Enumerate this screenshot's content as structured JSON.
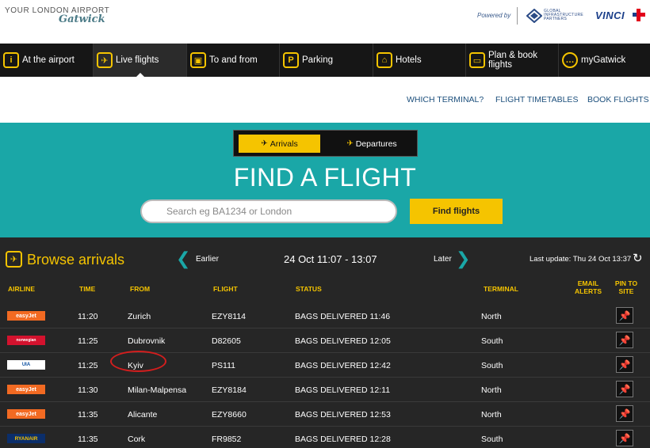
{
  "brand": {
    "tagline": "YOUR LONDON AIRPORT",
    "name": "Gatwick",
    "powered_by": "Powered by",
    "partner_lines": [
      "GLOBAL",
      "INFRASTRUCTURE",
      "PARTNERS"
    ],
    "partner2": "VINCI"
  },
  "nav": {
    "items": [
      {
        "label": "At the airport",
        "icon": "info-icon",
        "glyph": "i"
      },
      {
        "label": "Live flights",
        "icon": "plane-icon",
        "glyph": "✈"
      },
      {
        "label": "To and from",
        "icon": "train-icon",
        "glyph": "▣"
      },
      {
        "label": "Parking",
        "icon": "parking-icon",
        "glyph": "P"
      },
      {
        "label": "Hotels",
        "icon": "bed-icon",
        "glyph": "⌂"
      },
      {
        "label": "Plan & book flights",
        "icon": "ticket-icon",
        "glyph": "▭"
      },
      {
        "label": "myGatwick",
        "icon": "chat-icon",
        "glyph": "…"
      }
    ]
  },
  "sublinks": [
    "WHICH TERMINAL?",
    "FLIGHT TIMETABLES",
    "BOOK FLIGHTS"
  ],
  "hero": {
    "arrivals": "Arrivals",
    "departures": "Departures",
    "title": "FIND A FLIGHT",
    "search_placeholder": "Search eg BA1234 or London",
    "find_button": "Find flights"
  },
  "browse": {
    "title": "Browse arrivals",
    "earlier": "Earlier",
    "range": "24 Oct  11:07 - 13:07",
    "later": "Later",
    "last_update": "Last update: Thu 24 Oct 13:37"
  },
  "table": {
    "headers": {
      "airline": "AIRLINE",
      "time": "TIME",
      "from": "FROM",
      "flight": "FLIGHT",
      "status": "STATUS",
      "terminal": "TERMINAL",
      "email": [
        "EMAIL",
        "ALERTS"
      ],
      "pin": [
        "PIN TO",
        "SITE"
      ]
    },
    "rows": [
      {
        "airline": "easyJet",
        "time": "11:20",
        "from": "Zurich",
        "flight": "EZY8114",
        "status": "BAGS DELIVERED 11:46",
        "terminal": "North"
      },
      {
        "airline": "norwegian",
        "time": "11:25",
        "from": "Dubrovnik",
        "flight": "D82605",
        "status": "BAGS DELIVERED 12:05",
        "terminal": "South"
      },
      {
        "airline": "UIA",
        "time": "11:25",
        "from": "Kyiv",
        "flight": "PS111",
        "status": "BAGS DELIVERED 12:42",
        "terminal": "South"
      },
      {
        "airline": "easyJet",
        "time": "11:30",
        "from": "Milan-Malpensa",
        "flight": "EZY8184",
        "status": "BAGS DELIVERED 12:11",
        "terminal": "North"
      },
      {
        "airline": "easyJet",
        "time": "11:35",
        "from": "Alicante",
        "flight": "EZY8660",
        "status": "BAGS DELIVERED 12:53",
        "terminal": "North"
      },
      {
        "airline": "RYANAIR",
        "time": "11:35",
        "from": "Cork",
        "flight": "FR9852",
        "status": "BAGS DELIVERED 12:28",
        "terminal": "South"
      }
    ]
  },
  "colors": {
    "accent": "#f5c400",
    "teal": "#1aa7a7",
    "dark": "#262626",
    "easyjet": "#f26a22",
    "norwegian": "#d3122e",
    "ryanair": "#0b2e6a",
    "highlight": "#d21e1e"
  }
}
